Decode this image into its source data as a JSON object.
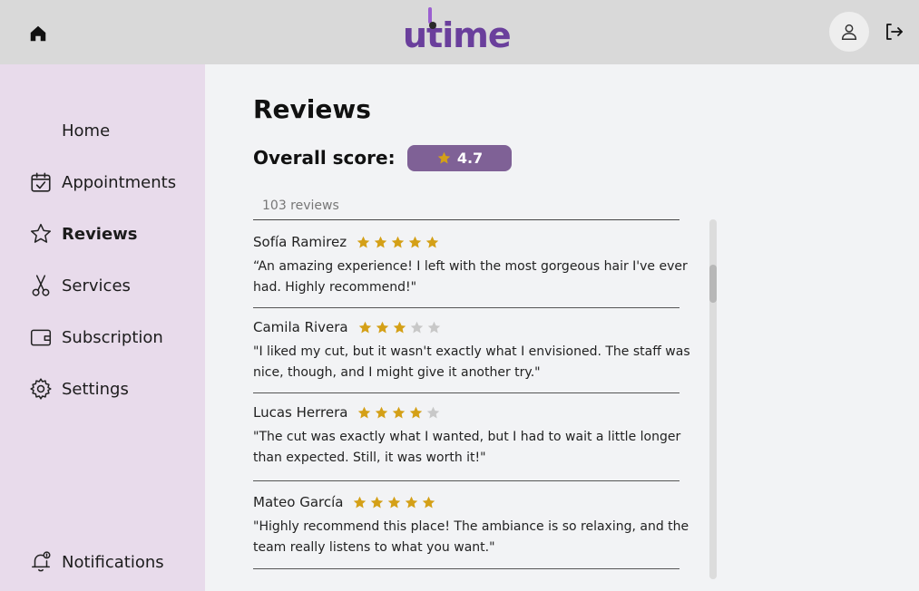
{
  "header": {
    "logo_text": "utime",
    "icons": {
      "home": "home-icon",
      "profile": "user-icon",
      "logout": "logout-icon"
    }
  },
  "sidebar": {
    "items": [
      {
        "label": "Home",
        "icon": "none",
        "active": false
      },
      {
        "label": "Appointments",
        "icon": "calendar-check-icon",
        "active": false
      },
      {
        "label": "Reviews",
        "icon": "star-outline-icon",
        "active": true
      },
      {
        "label": "Services",
        "icon": "scissors-icon",
        "active": false
      },
      {
        "label": "Subscription",
        "icon": "wallet-icon",
        "active": false
      },
      {
        "label": "Settings",
        "icon": "gear-icon",
        "active": false
      }
    ],
    "notifications": {
      "label": "Notifications",
      "icon": "bell-alert-icon"
    }
  },
  "main": {
    "title": "Reviews",
    "score_label": "Overall score:",
    "score_value": "4.7",
    "review_count": "103 reviews",
    "reviews": [
      {
        "name": "Sofía Ramirez",
        "rating": 5,
        "text": "“An amazing experience! I left with the most gorgeous hair I've ever had. Highly recommend!\""
      },
      {
        "name": "Camila Rivera",
        "rating": 3,
        "text": "\"I liked my cut, but it wasn't exactly what I envisioned. The staff was nice, though, and I might give it another try.\""
      },
      {
        "name": "Lucas Herrera",
        "rating": 4,
        "text": "\"The cut was exactly what I wanted, but I had to wait a little longer than expected. Still, it was worth it!\""
      },
      {
        "name": "Mateo García",
        "rating": 5,
        "text": "\"Highly recommend this place! The ambiance is so relaxing, and the team really listens to what you want.\""
      }
    ]
  },
  "colors": {
    "header_bg": "#d9d9d9",
    "sidebar_bg": "#e8dbeb",
    "brand_purple": "#6a3f9c",
    "score_pill": "#7f6196",
    "star_filled": "#d4a017",
    "star_empty": "#c8c8c8"
  }
}
